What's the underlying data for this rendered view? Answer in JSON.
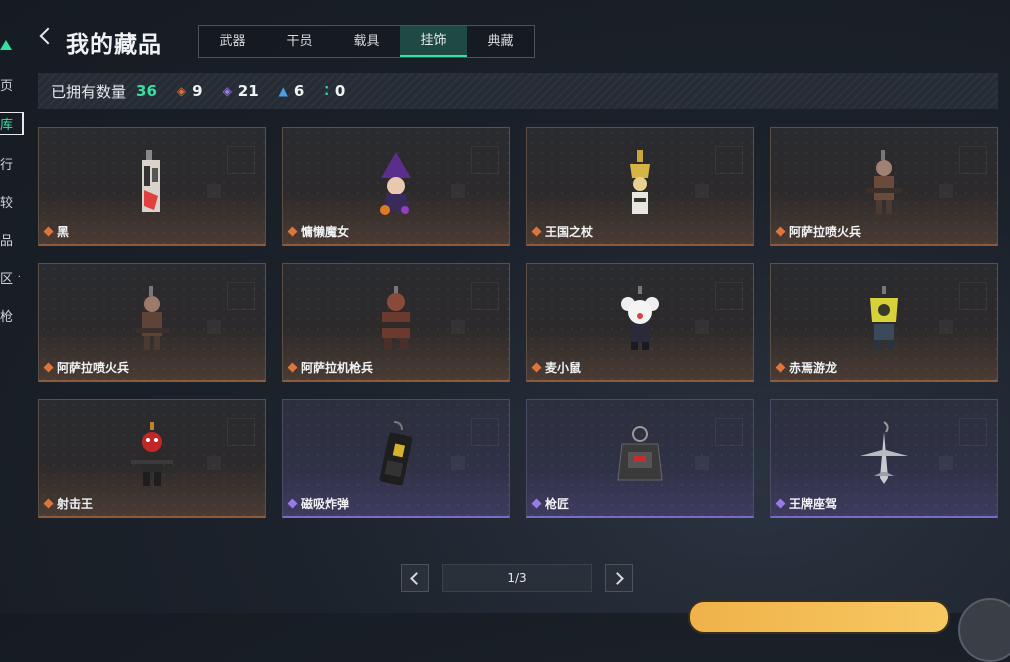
{
  "sidebar": {
    "items": [
      {
        "label": "页",
        "active": false
      },
      {
        "label": "库",
        "active": true
      },
      {
        "label": "行",
        "active": false
      },
      {
        "label": "较",
        "active": false
      },
      {
        "label": "品",
        "active": false
      },
      {
        "label": "区 ^",
        "active": false
      },
      {
        "label": "枪",
        "active": false
      }
    ]
  },
  "header": {
    "title": "我的藏品",
    "tabs": [
      "武器",
      "干员",
      "载具",
      "挂饰",
      "典藏"
    ],
    "active_tab": "挂饰"
  },
  "stats": {
    "owned_label": "已拥有数量",
    "owned_total": "36",
    "counts": [
      {
        "icon": "orange-diamond-icon",
        "value": "9",
        "color": "#e0753a"
      },
      {
        "icon": "purple-diamond-icon",
        "value": "21",
        "color": "#9a7ae8"
      },
      {
        "icon": "blue-chevron-icon",
        "value": "6",
        "color": "#4aa0e8"
      },
      {
        "icon": "green-dots-icon",
        "value": "0",
        "color": "#35e0a0"
      }
    ]
  },
  "items": [
    {
      "name": "黑",
      "rarity": "orange"
    },
    {
      "name": "慵懒魔女",
      "rarity": "orange"
    },
    {
      "name": "王国之杖",
      "rarity": "orange"
    },
    {
      "name": "阿萨拉喷火兵",
      "rarity": "orange"
    },
    {
      "name": "阿萨拉喷火兵",
      "rarity": "orange"
    },
    {
      "name": "阿萨拉机枪兵",
      "rarity": "orange"
    },
    {
      "name": "麦小鼠",
      "rarity": "orange"
    },
    {
      "name": "赤焉游龙",
      "rarity": "orange"
    },
    {
      "name": "射击王",
      "rarity": "orange"
    },
    {
      "name": "磁吸炸弹",
      "rarity": "purple"
    },
    {
      "name": "枪匠",
      "rarity": "purple"
    },
    {
      "name": "王牌座驾",
      "rarity": "purple"
    }
  ],
  "pagination": {
    "label": "1/3"
  },
  "colors": {
    "accent": "#35e0a0",
    "orange_rarity": "#e0753a",
    "purple_rarity": "#9a7ae8"
  }
}
